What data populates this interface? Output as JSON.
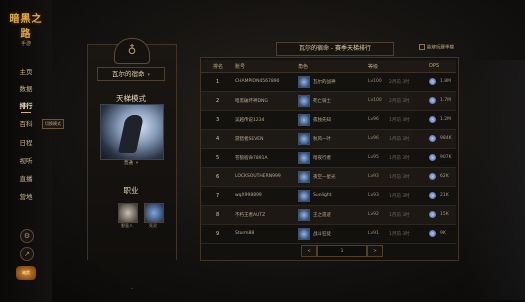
{
  "logo": {
    "main": "暗黑之路",
    "sub": "手游"
  },
  "nav": {
    "items": [
      {
        "label": "主页"
      },
      {
        "label": "数据"
      },
      {
        "label": "排行",
        "active": true
      },
      {
        "label": "百科"
      },
      {
        "label": "日程"
      },
      {
        "label": "视听"
      },
      {
        "label": "直播"
      },
      {
        "label": "营地"
      }
    ],
    "mode_button": "切换模式",
    "bottom_logo": "暗黑"
  },
  "character_panel": {
    "title": "瓦尔的宿命",
    "mode_title": "天梯模式",
    "portrait_label": "普通",
    "job_title": "职业",
    "jobs": [
      {
        "label": "野蛮人"
      },
      {
        "label": "死灵"
      }
    ]
  },
  "ranking": {
    "header": "瓦尔的宿命 - 赛季天梯排行",
    "link": "能够玩赛季模",
    "columns": [
      "排名",
      "账号",
      "角色",
      "等级",
      "DPS"
    ],
    "rows": [
      {
        "rank": "1",
        "account": "CHAMPION4567890",
        "character": "瓦尔的战神",
        "level": "Lv100",
        "time": "2月前 3时",
        "dps": "1.8M"
      },
      {
        "rank": "2",
        "account": "暗黑破坏神DNG",
        "character": "死亡骑士",
        "level": "Lv100",
        "time": "2月前 3时",
        "dps": "1.7M"
      },
      {
        "rank": "3",
        "account": "吴越传说1234",
        "character": "孤独先知",
        "level": "Lv96",
        "time": "1月前 3时",
        "dps": "1.2M"
      },
      {
        "rank": "4",
        "account": "游猎者SEVEN",
        "character": "秋风一叶",
        "level": "Lv96",
        "time": "1月前 3时",
        "dps": "984K"
      },
      {
        "rank": "5",
        "account": "苍狼宿命7891A",
        "character": "暗夜行者",
        "level": "Lv95",
        "time": "1月前 3时",
        "dps": "907K"
      },
      {
        "rank": "6",
        "account": "LOCKSOUTHERN999",
        "character": "夜空一星光",
        "level": "Lv93",
        "time": "1月前 3时",
        "dps": "62K"
      },
      {
        "rank": "7",
        "account": "wqX998899",
        "character": "Sunlight",
        "level": "Lv93",
        "time": "1月前 3时",
        "dps": "21K"
      },
      {
        "rank": "8",
        "account": "不朽王者AUTZ",
        "character": "王之遗迹",
        "level": "Lv92",
        "time": "1月前 3时",
        "dps": "15K"
      },
      {
        "rank": "9",
        "account": "Storm88",
        "character": "战斗狂徒",
        "level": "Lv91",
        "time": "1月前 3时",
        "dps": "9K"
      }
    ],
    "pager": {
      "prev": "<",
      "page": "1",
      "next": ">"
    }
  },
  "colors": {
    "background": "#0d0c0b",
    "gold": "#d8a84a",
    "panel_border": "#3f3427"
  }
}
